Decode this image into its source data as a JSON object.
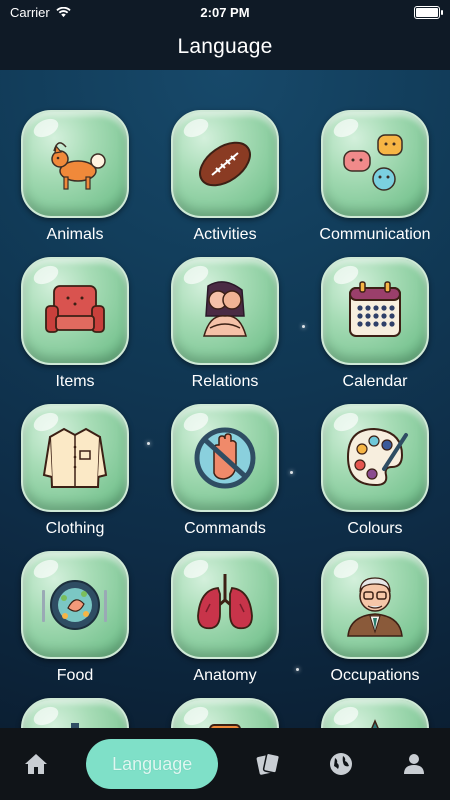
{
  "status": {
    "carrier": "Carrier",
    "time": "2:07 PM"
  },
  "header": {
    "title": "Language"
  },
  "categories": [
    {
      "label": "Animals",
      "icon": "dog-icon"
    },
    {
      "label": "Activities",
      "icon": "football-icon"
    },
    {
      "label": "Communication",
      "icon": "chat-bubbles-icon"
    },
    {
      "label": "Items",
      "icon": "armchair-icon"
    },
    {
      "label": "Relations",
      "icon": "hugging-people-icon"
    },
    {
      "label": "Calendar",
      "icon": "calendar-icon"
    },
    {
      "label": "Clothing",
      "icon": "shirt-icon"
    },
    {
      "label": "Commands",
      "icon": "stop-hand-icon"
    },
    {
      "label": "Colours",
      "icon": "palette-icon"
    },
    {
      "label": "Food",
      "icon": "food-plate-icon"
    },
    {
      "label": "Anatomy",
      "icon": "lungs-icon"
    },
    {
      "label": "Occupations",
      "icon": "professor-icon"
    }
  ],
  "tabbar": {
    "active_label": "Language",
    "tabs": [
      "home-icon",
      "language-tab",
      "cards-icon",
      "globe-icon",
      "profile-icon"
    ]
  }
}
